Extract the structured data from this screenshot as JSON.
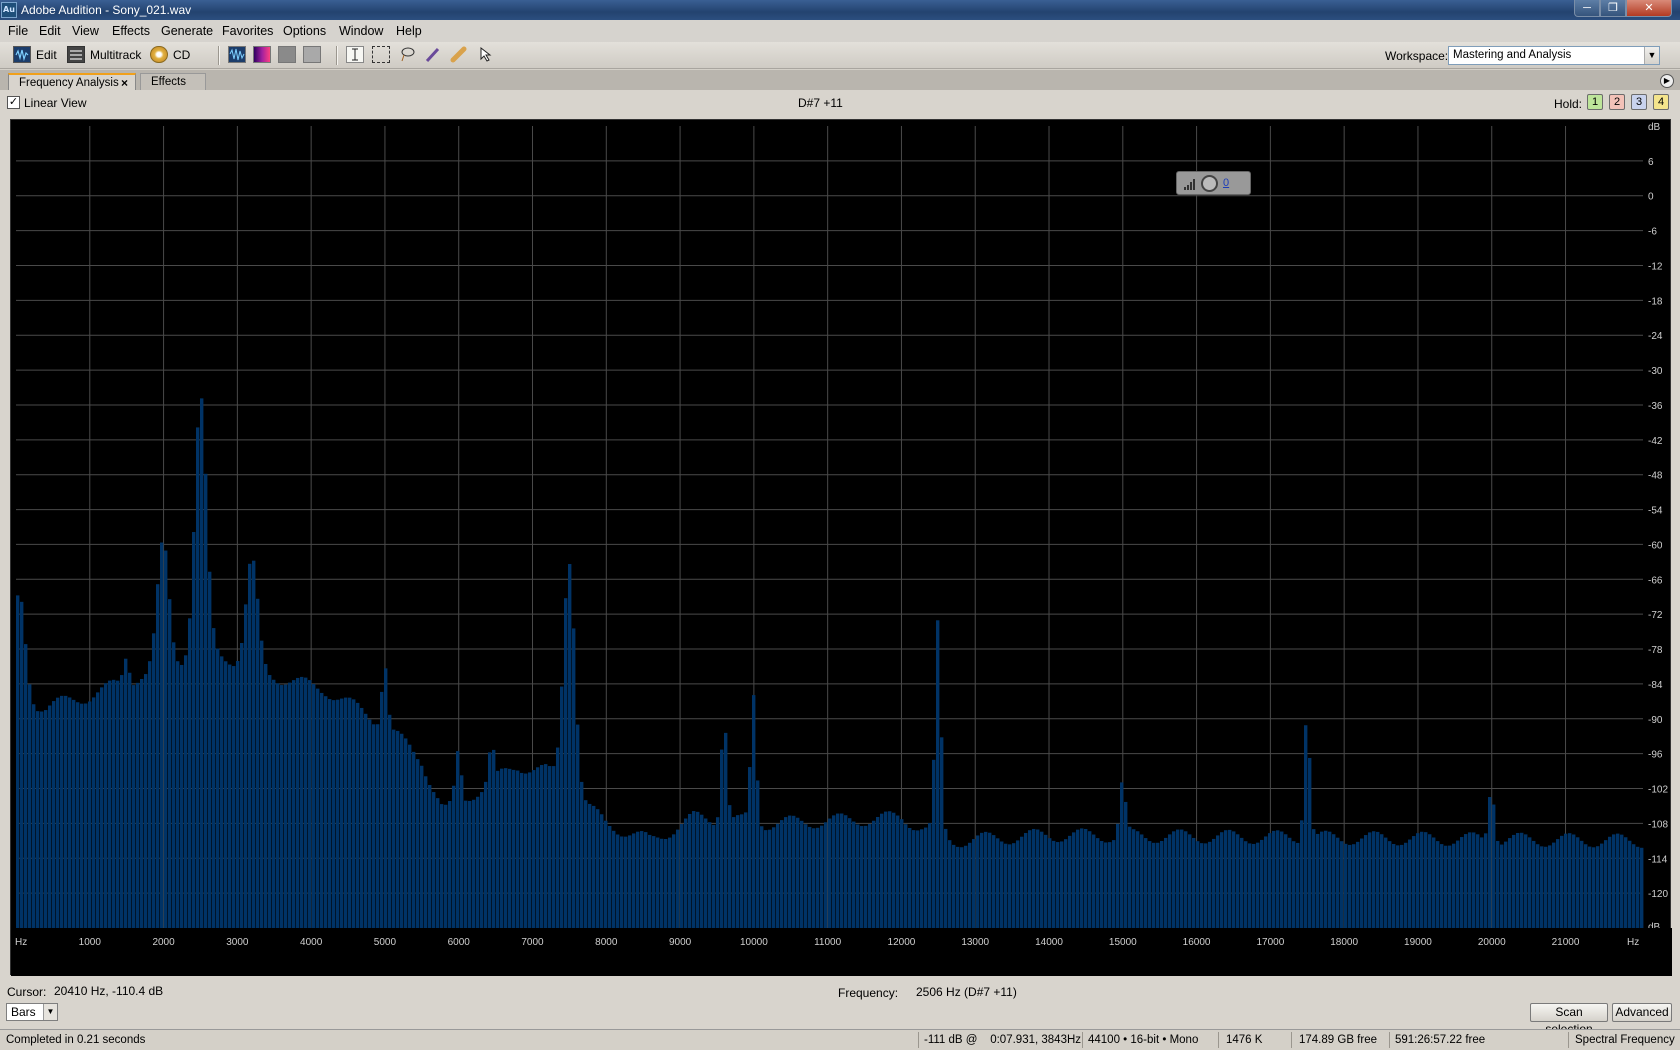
{
  "window": {
    "app_icon": "Au",
    "title": "Adobe Audition - Sony_021.wav",
    "controls": [
      "─",
      "❐",
      "✕"
    ]
  },
  "menu": [
    "File",
    "Edit",
    "View",
    "Effects",
    "Generate",
    "Favorites",
    "Options",
    "Window",
    "Help"
  ],
  "toolbar": {
    "edit_label": "Edit",
    "multitrack_label": "Multitrack",
    "cd_label": "CD",
    "workspace_label": "Workspace:",
    "workspace_value": "Mastering and Analysis",
    "dropdown_arrow": "▼"
  },
  "tabs": {
    "active": "Frequency Analysis",
    "close": "×",
    "inactive": "Effects",
    "menu_glyph": "▶"
  },
  "panel": {
    "linear_view_label": "Linear View",
    "linear_checked_glyph": "✓",
    "note_readout": "D#7 +11",
    "hold_label": "Hold:",
    "hold_buttons": [
      "1",
      "2",
      "3",
      "4"
    ],
    "hold_colors": [
      "#bde59a",
      "#f3c2b8",
      "#c9d3ee",
      "#f4e48c"
    ],
    "gain_value": "0"
  },
  "chart_data": {
    "type": "bar",
    "x_unit": "Hz",
    "y_unit": "dB",
    "xlim": [
      0,
      22050
    ],
    "ylim": [
      -126,
      12
    ],
    "x_ticks": [
      1000,
      2000,
      3000,
      4000,
      5000,
      6000,
      7000,
      8000,
      9000,
      10000,
      11000,
      12000,
      13000,
      14000,
      15000,
      16000,
      17000,
      18000,
      19000,
      20000,
      21000
    ],
    "y_ticks": [
      6,
      0,
      -6,
      -12,
      -18,
      -24,
      -30,
      -36,
      -42,
      -48,
      -54,
      -60,
      -66,
      -72,
      -78,
      -84,
      -90,
      -96,
      -102,
      -108,
      -114,
      -120
    ],
    "grid": true,
    "bar_color": "#003366",
    "peaks": [
      {
        "freq": 50,
        "db": -69
      },
      {
        "freq": 1500,
        "db": -79
      },
      {
        "freq": 2000,
        "db": -60
      },
      {
        "freq": 2506,
        "db": -35
      },
      {
        "freq": 3200,
        "db": -63
      },
      {
        "freq": 5000,
        "db": -80
      },
      {
        "freq": 6000,
        "db": -96
      },
      {
        "freq": 6450,
        "db": -95
      },
      {
        "freq": 7500,
        "db": -62
      },
      {
        "freq": 9600,
        "db": -89
      },
      {
        "freq": 10000,
        "db": -86
      },
      {
        "freq": 12500,
        "db": -74
      },
      {
        "freq": 15000,
        "db": -101
      },
      {
        "freq": 17500,
        "db": -88
      },
      {
        "freq": 20000,
        "db": -101
      }
    ],
    "floor": [
      [
        0,
        -86
      ],
      [
        400,
        -88
      ],
      [
        1000,
        -86
      ],
      [
        2600,
        -78
      ],
      [
        3600,
        -83
      ],
      [
        4200,
        -85
      ],
      [
        5000,
        -91
      ],
      [
        5500,
        -97
      ],
      [
        5800,
        -106
      ],
      [
        6800,
        -98
      ],
      [
        7200,
        -99
      ],
      [
        8000,
        -108
      ],
      [
        8600,
        -111
      ],
      [
        9200,
        -107
      ],
      [
        10200,
        -108
      ],
      [
        12000,
        -107
      ],
      [
        12700,
        -111
      ],
      [
        14000,
        -110
      ],
      [
        22050,
        -111
      ]
    ]
  },
  "info": {
    "cursor_label": "Cursor:",
    "cursor_value": "20410 Hz, -110.4 dB",
    "frequency_label": "Frequency:",
    "frequency_value": "2506 Hz (D#7 +11)",
    "display_mode": "Bars",
    "scan_selection": "Scan selection",
    "advanced": "Advanced"
  },
  "status": {
    "completed": "Completed in 0.21 seconds",
    "level": "-111 dB @    0:07.931, 3843Hz",
    "format": "44100 • 16-bit • Mono",
    "size": "1476 K",
    "disk_free": "174.89 GB free",
    "time_free": "591:26:57.22 free",
    "view": "Spectral Frequency"
  }
}
